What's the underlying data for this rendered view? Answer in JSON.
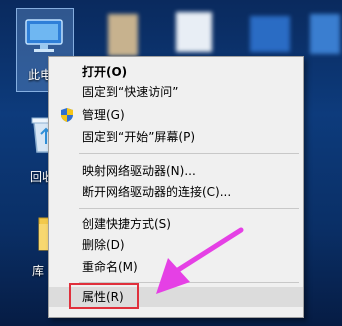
{
  "desktop": {
    "icons": [
      {
        "label": "此电脑",
        "icon": "computer-icon"
      },
      {
        "label": "回收站",
        "icon": "recycle-bin-icon"
      },
      {
        "label": "库",
        "icon": "folder-icon"
      }
    ]
  },
  "context_menu": {
    "items": [
      {
        "label": "打开(O)",
        "bold": true
      },
      {
        "label": "固定到“快速访问”"
      },
      {
        "label": "管理(G)",
        "icon": "shield-icon"
      },
      {
        "label": "固定到“开始”屏幕(P)"
      },
      {
        "label": "映射网络驱动器(N)..."
      },
      {
        "label": "断开网络驱动器的连接(C)..."
      },
      {
        "label": "创建快捷方式(S)"
      },
      {
        "label": "删除(D)"
      },
      {
        "label": "重命名(M)"
      },
      {
        "label": "属性(R)",
        "highlighted": true
      }
    ]
  },
  "annotation": {
    "arrow_color": "#e540e5",
    "box_color": "#e0303c"
  }
}
